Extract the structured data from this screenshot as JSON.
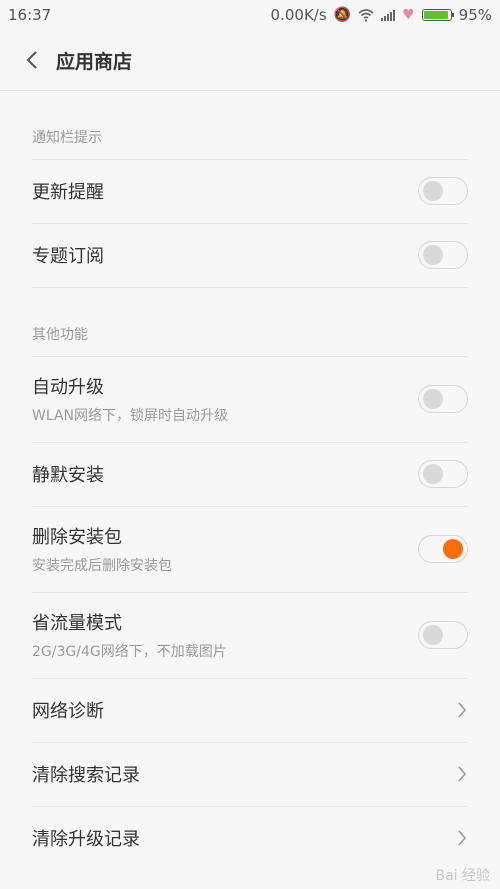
{
  "status": {
    "time": "16:37",
    "network_speed": "0.00K/s",
    "battery_text": "95%",
    "battery_level_percent": 95,
    "icons": [
      "mute-icon",
      "wifi-icon",
      "signal-icon",
      "heart-icon",
      "battery-icon"
    ]
  },
  "header": {
    "title": "应用商店"
  },
  "sections": {
    "notifications": "通知栏提示",
    "other": "其他功能"
  },
  "items": {
    "update_reminder": {
      "label": "更新提醒",
      "on": false
    },
    "topic_subscription": {
      "label": "专题订阅",
      "on": false
    },
    "auto_upgrade": {
      "label": "自动升级",
      "sub": "WLAN网络下，锁屏时自动升级",
      "on": false
    },
    "silent_install": {
      "label": "静默安装",
      "on": false
    },
    "delete_package": {
      "label": "删除安装包",
      "sub": "安装完成后删除安装包",
      "on": true
    },
    "data_saver": {
      "label": "省流量模式",
      "sub": "2G/3G/4G网络下，不加载图片",
      "on": false
    },
    "network_diagnosis": {
      "label": "网络诊断"
    },
    "clear_search": {
      "label": "清除搜索记录"
    },
    "clear_upgrade": {
      "label": "清除升级记录"
    }
  },
  "colors": {
    "accent": "#ff6d0c",
    "background": "#f7f7f7",
    "battery": "#5bc236"
  },
  "watermark": "Bai 经验"
}
